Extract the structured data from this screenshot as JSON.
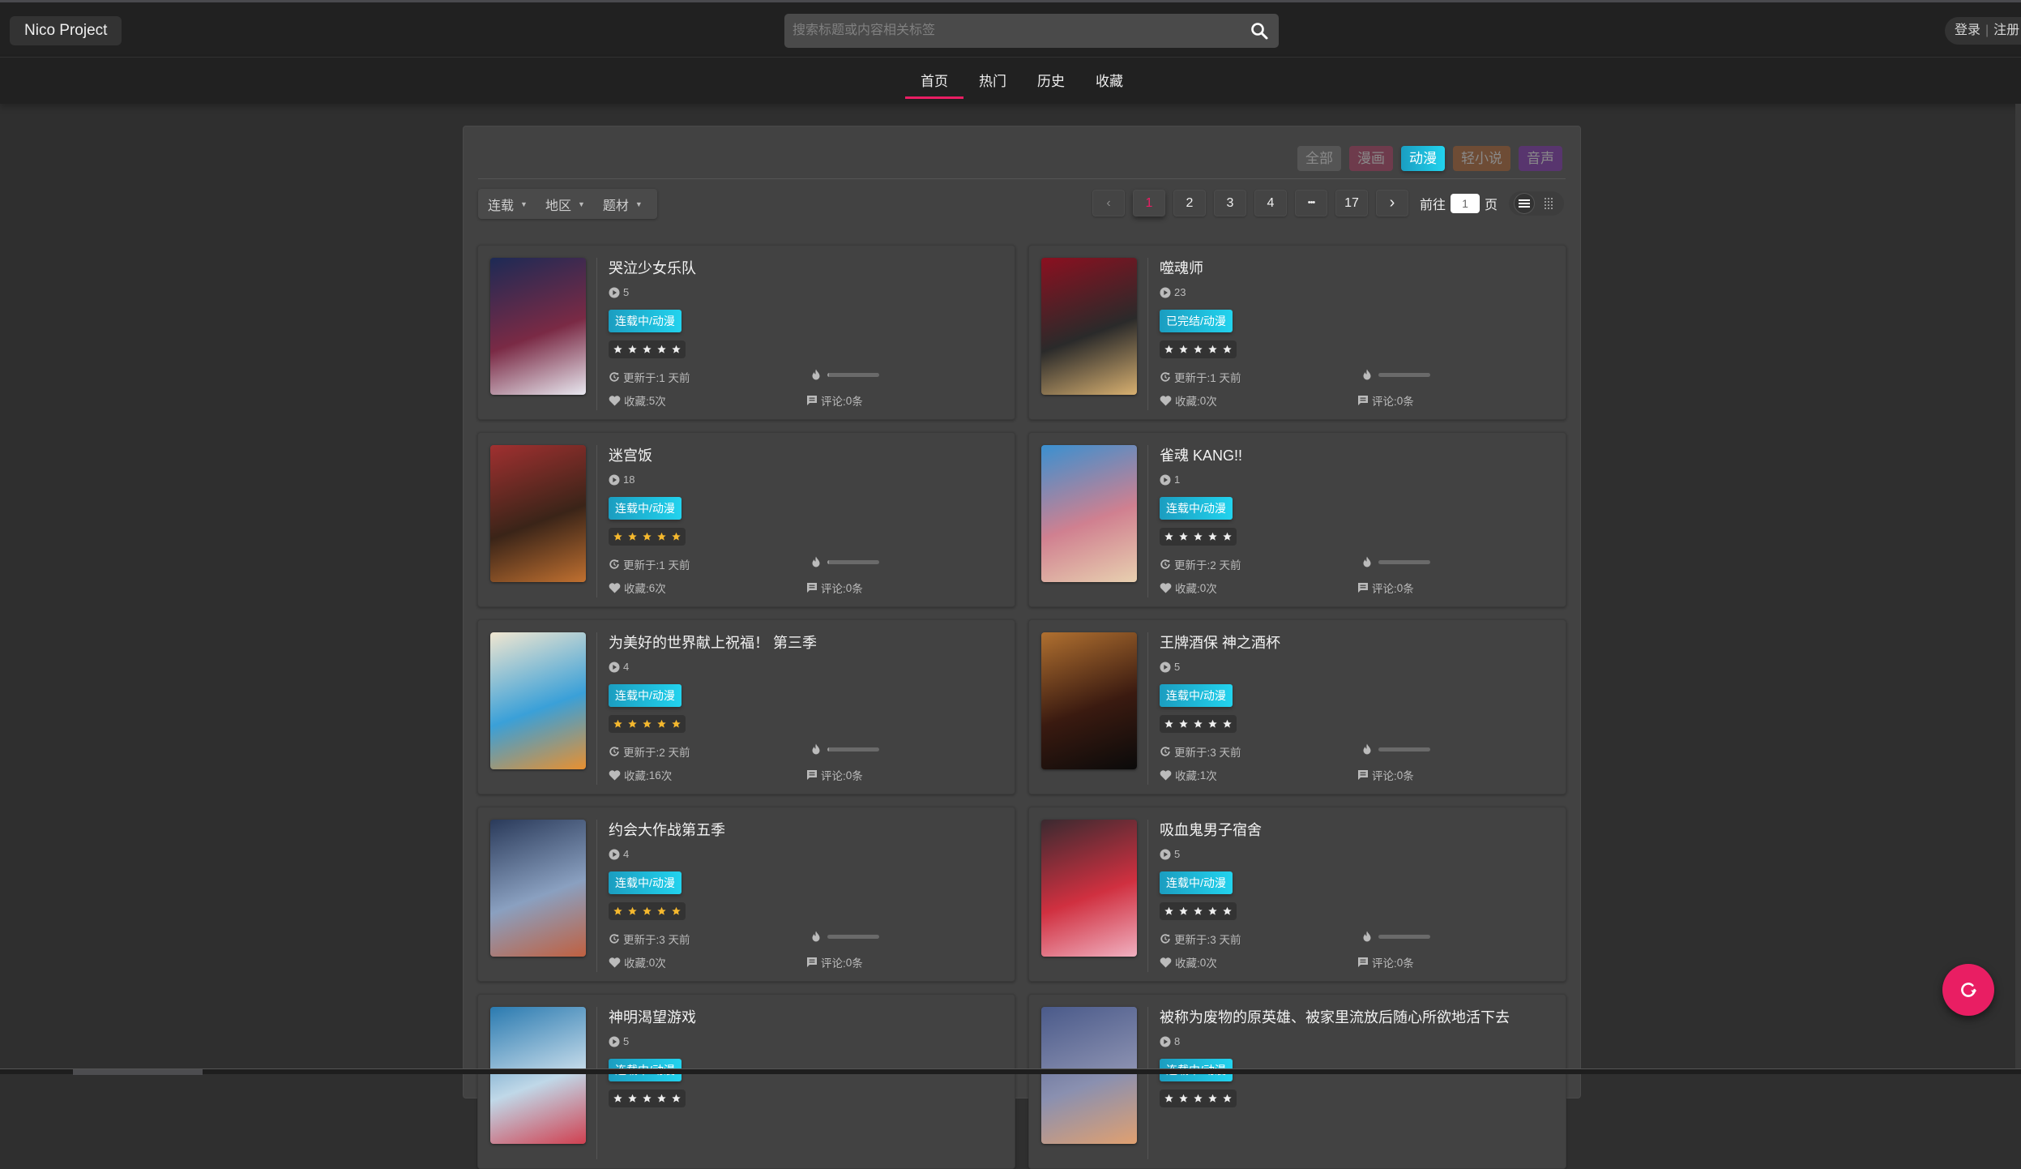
{
  "header": {
    "logo": "Nico Project",
    "search_placeholder": "搜索标题或内容相关标签",
    "search_value": "",
    "login": "登录",
    "separator": "|",
    "register": "注册"
  },
  "nav": {
    "tabs": [
      {
        "label": "首页",
        "active": true
      },
      {
        "label": "热门",
        "active": false
      },
      {
        "label": "历史",
        "active": false
      },
      {
        "label": "收藏",
        "active": false
      }
    ]
  },
  "types": [
    {
      "label": "全部",
      "color": "#555555",
      "active": false
    },
    {
      "label": "漫画",
      "color": "#6e3b4c",
      "active": false
    },
    {
      "label": "动漫",
      "color": "#1fb6d8",
      "active": true
    },
    {
      "label": "轻小说",
      "color": "#6e4c35",
      "active": false
    },
    {
      "label": "音声",
      "color": "#58356e",
      "active": false
    }
  ],
  "filters": [
    {
      "label": "连载"
    },
    {
      "label": "地区"
    },
    {
      "label": "题材"
    }
  ],
  "pagination": {
    "prev": "‹",
    "pages": [
      "1",
      "2",
      "3",
      "4",
      "•••",
      "17"
    ],
    "current": "1",
    "next": "›",
    "goto_prefix": "前往",
    "goto_value": "1",
    "goto_suffix": "页"
  },
  "view_modes": [
    {
      "name": "list",
      "active": true
    },
    {
      "name": "grid",
      "active": false
    }
  ],
  "labels": {
    "updated_prefix": "更新于: ",
    "fav_prefix": "收藏: ",
    "fav_suffix": " 次",
    "comment_prefix": "评论: ",
    "comment_suffix": " 条"
  },
  "colors": {
    "accent": "#e91e63",
    "status_gradient_start": "#1b9dc0",
    "status_gradient_end": "#22d3ee",
    "star_gold": "#f5b82e",
    "star_white": "#eeeeee"
  },
  "items": [
    {
      "title": "哭泣少女乐队",
      "episodes": "5",
      "status": "连载中/动漫",
      "stars_gold": false,
      "rating": 5,
      "updated": "1 天前",
      "favorites": "5",
      "comments": "0",
      "heat": 0.03,
      "cover": [
        "#1d2a55",
        "#7a2a45",
        "#e8e8f0"
      ]
    },
    {
      "title": "噬魂师",
      "episodes": "23",
      "status": "已完结/动漫",
      "stars_gold": false,
      "rating": 5,
      "updated": "1 天前",
      "favorites": "0",
      "comments": "0",
      "heat": 0.0,
      "cover": [
        "#8b1020",
        "#2a2a2a",
        "#d8b070"
      ]
    },
    {
      "title": "迷宫饭",
      "episodes": "18",
      "status": "连载中/动漫",
      "stars_gold": true,
      "rating": 5,
      "updated": "1 天前",
      "favorites": "6",
      "comments": "0",
      "heat": 0.03,
      "cover": [
        "#a03030",
        "#3a2418",
        "#c07030"
      ]
    },
    {
      "title": "雀魂 KANG!!",
      "episodes": "1",
      "status": "连载中/动漫",
      "stars_gold": false,
      "rating": 5,
      "updated": "2 天前",
      "favorites": "0",
      "comments": "0",
      "heat": 0.0,
      "cover": [
        "#3a90d0",
        "#d08090",
        "#e8d0b0"
      ]
    },
    {
      "title": "为美好的世界献上祝福！ 第三季",
      "episodes": "4",
      "status": "连载中/动漫",
      "stars_gold": true,
      "rating": 5,
      "updated": "2 天前",
      "favorites": "16",
      "comments": "0",
      "heat": 0.03,
      "cover": [
        "#f0e6d0",
        "#3aa0d8",
        "#e89030"
      ]
    },
    {
      "title": "王牌酒保 神之酒杯",
      "episodes": "5",
      "status": "连载中/动漫",
      "stars_gold": false,
      "rating": 5,
      "updated": "3 天前",
      "favorites": "1",
      "comments": "0",
      "heat": 0.0,
      "cover": [
        "#b07030",
        "#3a1a10",
        "#0a0a0a"
      ]
    },
    {
      "title": "约会大作战第五季",
      "episodes": "4",
      "status": "连载中/动漫",
      "stars_gold": true,
      "rating": 5,
      "updated": "3 天前",
      "favorites": "0",
      "comments": "0",
      "heat": 0.0,
      "cover": [
        "#2a3a5a",
        "#8aa0c0",
        "#c06040"
      ]
    },
    {
      "title": "吸血鬼男子宿舍",
      "episodes": "5",
      "status": "连载中/动漫",
      "stars_gold": false,
      "rating": 5,
      "updated": "3 天前",
      "favorites": "0",
      "comments": "0",
      "heat": 0.0,
      "cover": [
        "#3a2a30",
        "#d03040",
        "#f0b0c0"
      ]
    },
    {
      "title": "神明渴望游戏",
      "episodes": "5",
      "status": "连载中/动漫",
      "stars_gold": false,
      "rating": 5,
      "updated": "",
      "favorites": "",
      "comments": "",
      "heat": 0.0,
      "cover": [
        "#2a7ab0",
        "#c0d8e8",
        "#d04050"
      ]
    },
    {
      "title": "被称为废物的原英雄、被家里流放后随心所欲地活下去",
      "episodes": "8",
      "status": "连载中/动漫",
      "stars_gold": false,
      "rating": 5,
      "updated": "",
      "favorites": "",
      "comments": "",
      "heat": 0.0,
      "cover": [
        "#4a5a8a",
        "#8a90b0",
        "#e0a070"
      ]
    }
  ]
}
